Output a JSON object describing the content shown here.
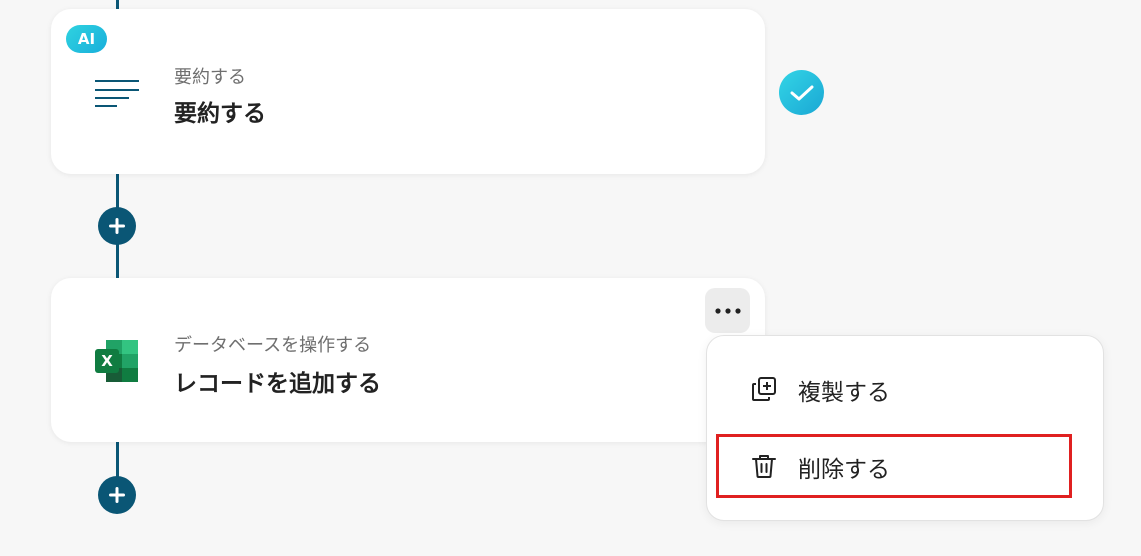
{
  "steps": [
    {
      "badge": "AI",
      "subtitle": "要約する",
      "title": "要約する",
      "icon": "summary-lines-icon",
      "status": "completed"
    },
    {
      "subtitle": "データベースを操作する",
      "title": "レコードを追加する",
      "icon": "excel-icon"
    }
  ],
  "menu": {
    "items": [
      {
        "label": "複製する",
        "icon": "duplicate-icon"
      },
      {
        "label": "削除する",
        "icon": "trash-icon",
        "highlighted": true
      }
    ]
  },
  "colors": {
    "accent": "#0a5675",
    "check_gradient_start": "#33d5e6",
    "check_gradient_end": "#1aa7d4",
    "highlight": "#e02020",
    "excel_green": "#1e7145"
  }
}
